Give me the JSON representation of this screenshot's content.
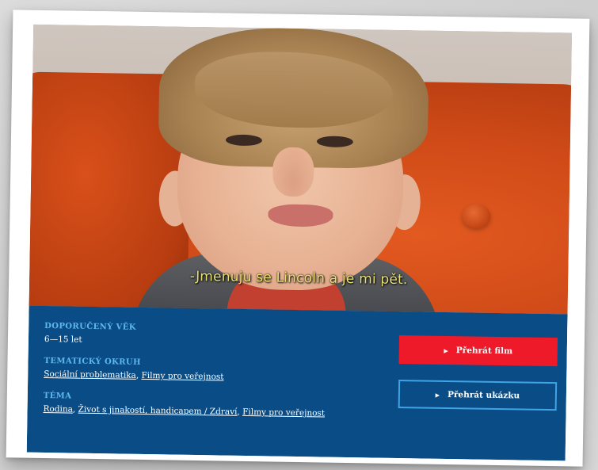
{
  "video": {
    "subtitle": "-Jmenuju se Lincoln a je mi pět."
  },
  "info": {
    "age": {
      "label": "DOPORUČENÝ VĚK",
      "value": "6—15 let"
    },
    "thematic": {
      "label": "TEMATICKÝ OKRUH",
      "links": [
        "Sociální problematika",
        "Filmy pro veřejnost"
      ]
    },
    "topic": {
      "label": "TÉMA",
      "links": [
        "Rodina",
        "Život s jinakostí, handicapem / Zdraví",
        "Filmy pro veřejnost"
      ]
    },
    "separator": ", "
  },
  "buttons": {
    "play_film": "Přehrát film",
    "play_trailer": "Přehrát ukázku"
  },
  "colors": {
    "panel": "#0a4d86",
    "label": "#5eb8ee",
    "primary_button": "#ee1a2a",
    "secondary_border": "#3fa3e6",
    "subtitle": "#e8e070"
  },
  "icons": {
    "play": "play-icon"
  }
}
